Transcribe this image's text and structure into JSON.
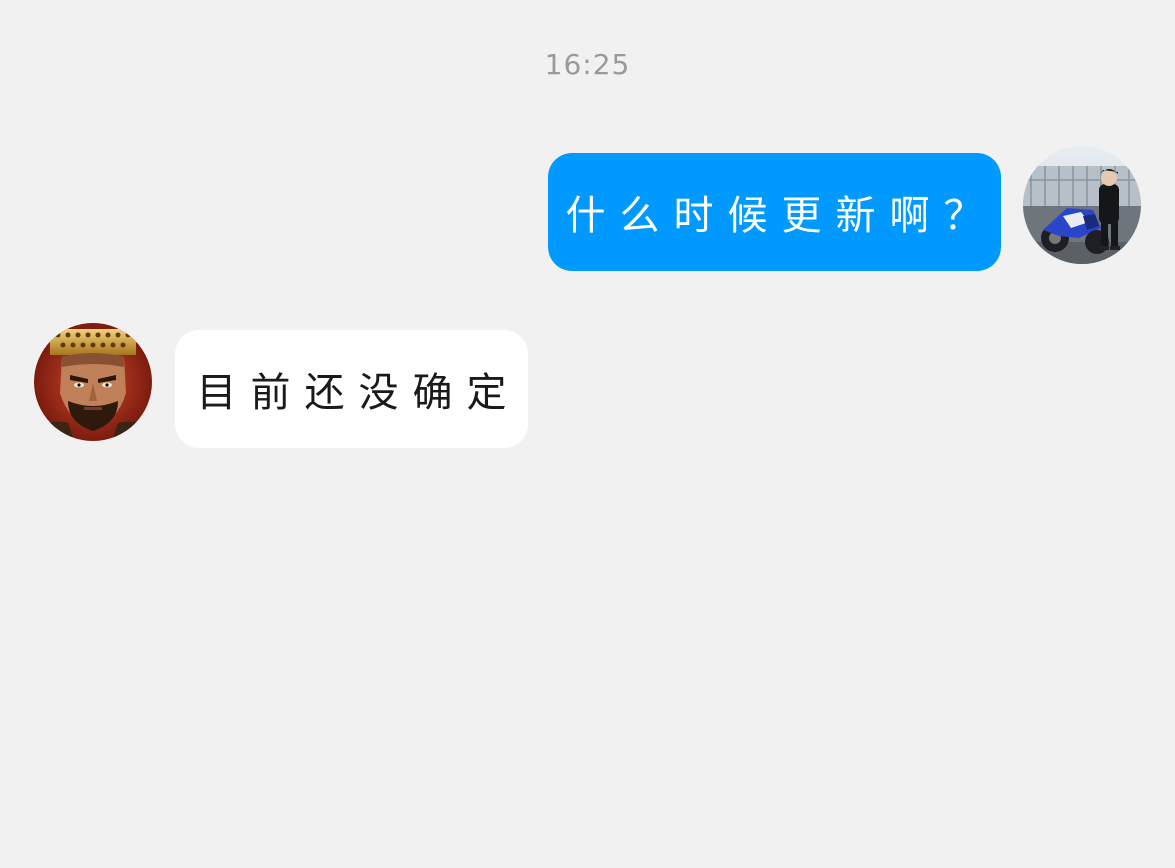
{
  "conversation": {
    "timestamp": "16:25",
    "messages": [
      {
        "sender": "self",
        "text": "什么时候更新啊？",
        "bubble_color": "#0099ff",
        "text_color": "#ffffff",
        "avatar_icon": "motorcycle-rider-avatar-icon"
      },
      {
        "sender": "other",
        "text": "目前还没确定",
        "bubble_color": "#ffffff",
        "text_color": "#1a1a1a",
        "avatar_icon": "warrior-avatar-icon"
      }
    ]
  },
  "colors": {
    "background": "#f1f1f1",
    "timestamp": "#9a9a9a"
  }
}
